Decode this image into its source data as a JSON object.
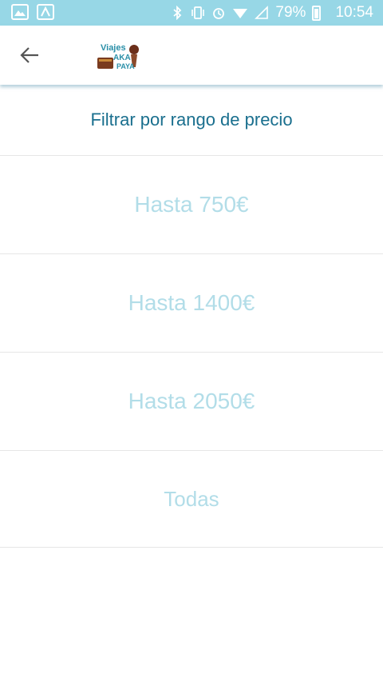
{
  "status_bar": {
    "battery_percent": "79%",
    "time": "10:54",
    "icons": [
      "image-icon",
      "app-icon",
      "bluetooth-icon",
      "vibrate-icon",
      "alarm-icon",
      "wifi-icon",
      "signal-icon",
      "battery-icon"
    ]
  },
  "appbar": {
    "back_icon": "arrow-left-icon",
    "logo_text_1": "Viajes",
    "logo_text_2": "AKA",
    "logo_text_3": "PAYA"
  },
  "filter": {
    "title": "Filtrar por rango de precio",
    "options": [
      {
        "label": "Hasta 750€"
      },
      {
        "label": "Hasta 1400€"
      },
      {
        "label": "Hasta 2050€"
      },
      {
        "label": "Todas"
      }
    ]
  },
  "colors": {
    "status_bar": "#97d7e6",
    "title_text": "#1a6f8e",
    "option_text": "#b2dde8"
  }
}
